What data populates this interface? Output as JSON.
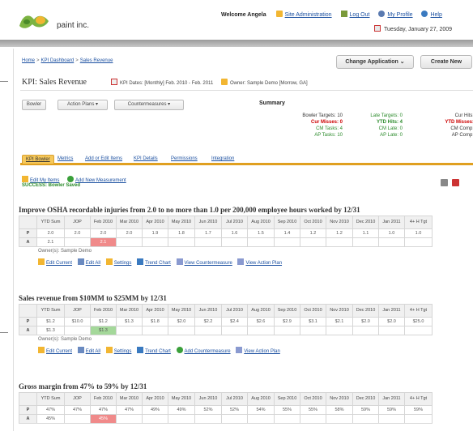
{
  "app": {
    "logo_text": "paint inc."
  },
  "topnav": {
    "welcome": "Welcome Angela",
    "items": [
      "Site Administration",
      "Log Out",
      "My Profile",
      "Help"
    ]
  },
  "date": "Tuesday, January 27, 2009",
  "breadcrumb": [
    "Home",
    "KPI Dashboard",
    "Sales Revenue"
  ],
  "buttons": {
    "change_app": "Change Application",
    "create_new": "Create New"
  },
  "kpi": {
    "title": "KPI: Sales Revenue",
    "dates": "KPI Dates: [Monthly] Feb. 2010 - Feb. 2011",
    "owner": "Owner: Sample Demo [Morrow, GA]"
  },
  "dropdowns": [
    "Bowler",
    "Action Plans",
    "Countermeasures"
  ],
  "summary": {
    "title": "Summary",
    "col1": [
      "Bowler Targets: 10",
      "Cur Misses: 0",
      "CM Tasks: 4",
      "AP Tasks: 10"
    ],
    "col2": [
      "Late Targets: 0",
      "YTD Hits: 4",
      "CM Late: 0",
      "AP Late: 0"
    ],
    "col3": [
      "Cur Hits:",
      "YTD Misses:",
      "CM Comp:",
      "AP Comp:"
    ]
  },
  "tabs": [
    "KPI Bowler",
    "Metrics",
    "Add or Edit Items",
    "KPI Details",
    "Permissions",
    "Integration"
  ],
  "actions": {
    "edit_items": "Edit My Items",
    "add_measurement": "Add New Measurement",
    "success": "SUCCESS: Bowler Saved"
  },
  "columns": [
    "YTD Sum",
    "JOP",
    "Feb 2010",
    "Mar 2010",
    "Apr 2010",
    "May 2010",
    "Jun 2010",
    "Jul 2010",
    "Aug 2010",
    "Sep 2010",
    "Oct 2010",
    "Nov 2010",
    "Dec 2010",
    "Jan 2011",
    "4+ H Tgt"
  ],
  "measurements": [
    {
      "title": "Improve OSHA recordable injuries from 2.0 to no more than 1.0 per 200,000 employee hours worked by 12/31",
      "P": [
        "2.0",
        "2.0",
        "2.0",
        "2.0",
        "1.9",
        "1.8",
        "1.7",
        "1.6",
        "1.5",
        "1.4",
        "1.2",
        "1.2",
        "1.1",
        "1.0",
        "1.0"
      ],
      "A": [
        "2.1",
        "",
        "2.1",
        "",
        "",
        "",
        "",
        "",
        "",
        "",
        "",
        "",
        "",
        "",
        ""
      ],
      "owner": "Owner(s): Sample Demo",
      "links": [
        "Edit Current",
        "Edit All",
        "Settings",
        "Trend Chart",
        "View Countermeasure",
        "View Action Plan"
      ]
    },
    {
      "title": "Sales revenue from $10MM to $25MM by 12/31",
      "P": [
        "$1.2",
        "$10.0",
        "$1.2",
        "$1.3",
        "$1.8",
        "$2.0",
        "$2.2",
        "$2.4",
        "$2.6",
        "$2.9",
        "$3.1",
        "$2.1",
        "$2.0",
        "$2.0",
        "$25.0"
      ],
      "A": [
        "$1.3",
        "",
        "$1.3",
        "",
        "",
        "",
        "",
        "",
        "",
        "",
        "",
        "",
        "",
        "",
        ""
      ],
      "owner": "Owner(s): Sample Demo",
      "links": [
        "Edit Current",
        "Edit All",
        "Settings",
        "Trend Chart",
        "Add Countermeasure",
        "View Action Plan"
      ]
    },
    {
      "title": "Gross margin from 47% to 59% by 12/31",
      "P": [
        "47%",
        "47%",
        "47%",
        "47%",
        "49%",
        "49%",
        "52%",
        "52%",
        "54%",
        "55%",
        "55%",
        "58%",
        "59%",
        "59%",
        "59%"
      ],
      "A": [
        "45%",
        "",
        "45%",
        "",
        "",
        "",
        "",
        "",
        "",
        "",
        "",
        "",
        "",
        "",
        ""
      ]
    }
  ],
  "colors": {
    "accent": "#e0a020",
    "tab_active": "#f6c85a",
    "miss": "#f08a8a",
    "hit": "#a4d89a",
    "link": "#1a4fa0"
  }
}
